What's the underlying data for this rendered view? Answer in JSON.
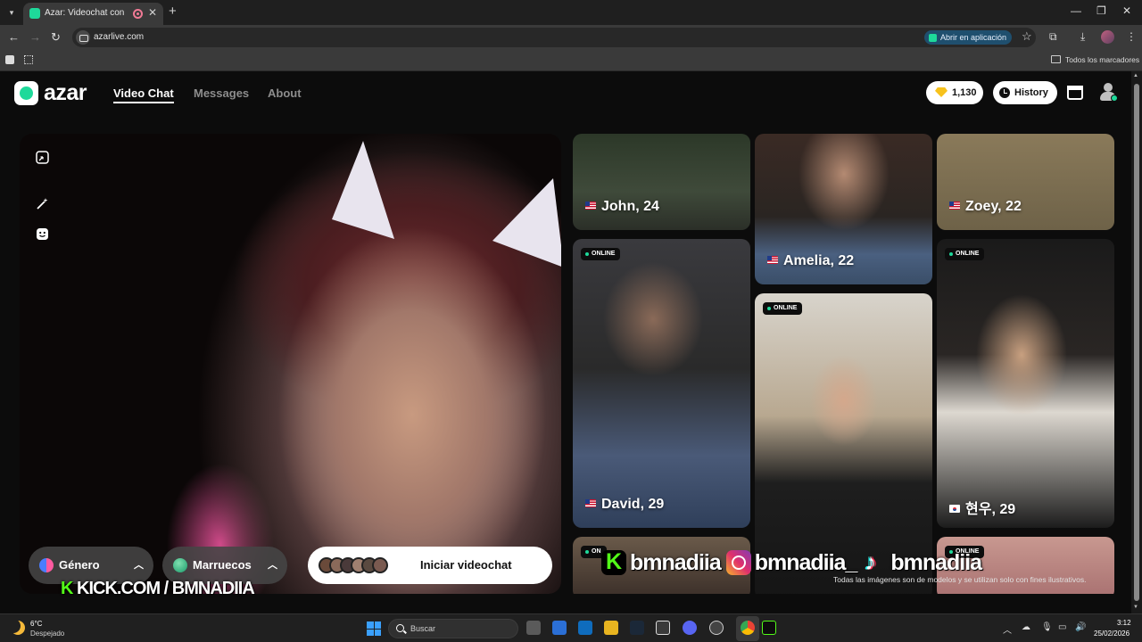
{
  "browser": {
    "tab_title": "Azar: Videochat con gente",
    "url": "azarlive.com",
    "open_in_app_label": "Abrir en aplicación",
    "bookmarks_all_label": "Todos los marcadores"
  },
  "header": {
    "logo_text": "azar",
    "nav": {
      "video_chat": "Video Chat",
      "messages": "Messages",
      "about": "About"
    },
    "gems_count": "1,130",
    "history_label": "History"
  },
  "camera": {
    "gender_label": "Género",
    "country_label": "Marruecos",
    "start_label": "Iniciar videochat"
  },
  "profiles": [
    {
      "name_age": "John, 24",
      "flag": "us"
    },
    {
      "name_age": "Amelia, 22",
      "flag": "us"
    },
    {
      "name_age": "Zoey, 22",
      "flag": "us"
    },
    {
      "name_age": "David, 29",
      "flag": "us",
      "badge": "ONLINE"
    },
    {
      "badge": "ONLINE"
    },
    {
      "name_age": "현우, 29",
      "flag": "kr",
      "badge": "ONLINE"
    },
    {
      "badge": "ON"
    },
    {
      "badge": "ONLINE"
    }
  ],
  "overlays": {
    "kick_channel": "KICK.COM / BMNADIIA",
    "kick_k": "K",
    "social_handle_kick": "bmnadiia",
    "social_handle_ig": "bmnadiia_",
    "social_handle_tiktok": "bmnadiia"
  },
  "disclaimer": "Todas las imágenes son de modelos y se utilizan solo con fines ilustrativos.",
  "taskbar": {
    "weather_temp": "6°C",
    "weather_desc": "Despejado",
    "search_placeholder": "Buscar",
    "time": "3:12",
    "date": "25/02/2026"
  },
  "colors": {
    "brand_green": "#1ed99a",
    "kick_green": "#53fc18",
    "gem_yellow": "#f7c21c"
  }
}
